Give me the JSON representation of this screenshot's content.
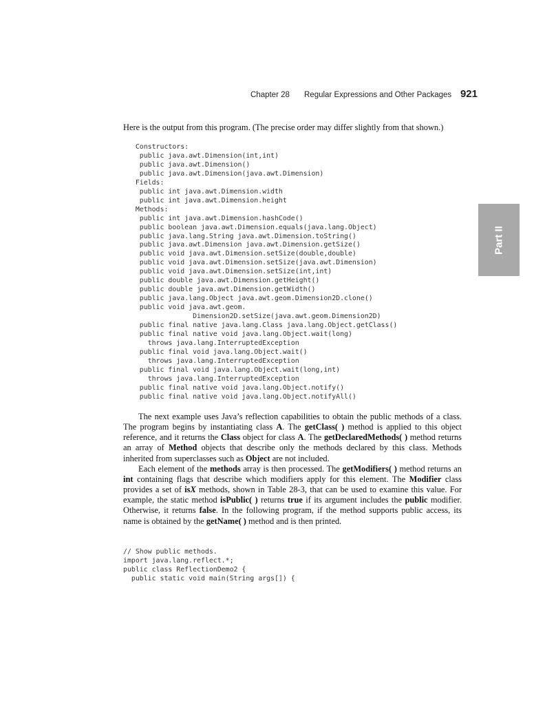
{
  "header": {
    "chapter": "Chapter 28",
    "title": "Regular Expressions and Other Packages",
    "page_number": "921"
  },
  "side_tab": {
    "label": "Part II"
  },
  "intro": "Here is the output from this program. (The precise order may differ slightly from that shown.)",
  "output_lines": [
    "   Constructors:",
    "    public java.awt.Dimension(int,int)",
    "    public java.awt.Dimension()",
    "    public java.awt.Dimension(java.awt.Dimension)",
    "   Fields:",
    "    public int java.awt.Dimension.width",
    "    public int java.awt.Dimension.height",
    "   Methods:",
    "    public int java.awt.Dimension.hashCode()",
    "    public boolean java.awt.Dimension.equals(java.lang.Object)",
    "    public java.lang.String java.awt.Dimension.toString()",
    "    public java.awt.Dimension java.awt.Dimension.getSize()",
    "    public void java.awt.Dimension.setSize(double,double)",
    "    public void java.awt.Dimension.setSize(java.awt.Dimension)",
    "    public void java.awt.Dimension.setSize(int,int)",
    "    public double java.awt.Dimension.getHeight()",
    "    public double java.awt.Dimension.getWidth()",
    "    public java.lang.Object java.awt.geom.Dimension2D.clone()",
    "    public void java.awt.geom.",
    "                 Dimension2D.setSize(java.awt.geom.Dimension2D)",
    "    public final native java.lang.Class java.lang.Object.getClass()",
    "    public final native void java.lang.Object.wait(long)",
    "      throws java.lang.InterruptedException",
    "    public final void java.lang.Object.wait()",
    "      throws java.lang.InterruptedException",
    "    public final void java.lang.Object.wait(long,int)",
    "      throws java.lang.InterruptedException",
    "    public final native void java.lang.Object.notify()",
    "    public final native void java.lang.Object.notifyAll()"
  ],
  "paragraphs": [
    [
      {
        "t": "The next example uses Java’s reflection capabilities to obtain the public methods of a class. The program begins by instantiating class "
      },
      {
        "t": "A",
        "b": true
      },
      {
        "t": ". The "
      },
      {
        "t": "getClass( )",
        "b": true
      },
      {
        "t": " method is applied to this object reference, and it returns the "
      },
      {
        "t": "Class",
        "b": true
      },
      {
        "t": " object for class "
      },
      {
        "t": "A",
        "b": true
      },
      {
        "t": ". The "
      },
      {
        "t": "getDeclaredMethods( )",
        "b": true
      },
      {
        "t": " method returns an array of "
      },
      {
        "t": "Method",
        "b": true
      },
      {
        "t": " objects that describe only the methods declared by this class. Methods inherited from superclasses such as "
      },
      {
        "t": "Object",
        "b": true
      },
      {
        "t": " are not included."
      }
    ],
    [
      {
        "t": "Each element of the "
      },
      {
        "t": "methods",
        "b": true
      },
      {
        "t": " array is then processed. The "
      },
      {
        "t": "getModifiers( )",
        "b": true
      },
      {
        "t": " method returns an "
      },
      {
        "t": "int",
        "b": true
      },
      {
        "t": " containing flags that describe which modifiers apply for this element. The "
      },
      {
        "t": "Modifier",
        "b": true
      },
      {
        "t": " class provides a set of "
      },
      {
        "t": "is",
        "b": true
      },
      {
        "t": "X",
        "b": true,
        "i": true
      },
      {
        "t": " methods, shown in Table 28-3, that can be used to examine this value. For example, the static method "
      },
      {
        "t": "isPublic( )",
        "b": true
      },
      {
        "t": " returns "
      },
      {
        "t": "true",
        "b": true
      },
      {
        "t": " if its argument includes the "
      },
      {
        "t": "public",
        "b": true
      },
      {
        "t": " modifier. Otherwise, it returns "
      },
      {
        "t": "false",
        "b": true
      },
      {
        "t": ". In the following program, if the method supports public access, its name is obtained by the "
      },
      {
        "t": "getName( )",
        "b": true
      },
      {
        "t": " method and is then printed."
      }
    ]
  ],
  "code_lines": [
    "// Show public methods.",
    "import java.lang.reflect.*;",
    "public class ReflectionDemo2 {",
    "  public static void main(String args[]) {"
  ]
}
